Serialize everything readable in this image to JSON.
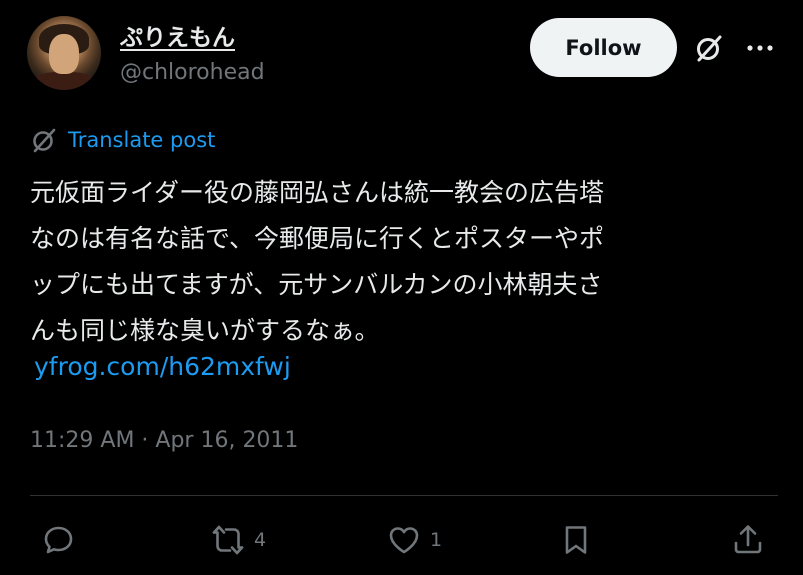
{
  "author": {
    "display_name": "ぷりえもん",
    "handle": "@chlorohead",
    "avatar_icon": "avatar"
  },
  "header": {
    "follow_label": "Follow",
    "grok_icon": "grok-icon",
    "more_icon": "more-icon"
  },
  "translate": {
    "icon": "translate-icon",
    "label": "Translate post"
  },
  "post": {
    "lines": [
      "元仮面ライダー役の藤岡弘さんは統一教会の広告塔",
      "なのは有名な話で、今郵便局に行くとポスターやポ",
      "ップにも出てますが、元サンバルカンの小林朝夫さ",
      "んも同じ様な臭いがするなぁ。"
    ],
    "link": "yfrog.com/h62mxfwj",
    "timestamp": "11:29 AM · Apr 16, 2011"
  },
  "actions": {
    "reply": {
      "icon": "reply-icon",
      "count": ""
    },
    "repost": {
      "icon": "repost-icon",
      "count": "4"
    },
    "like": {
      "icon": "heart-icon",
      "count": "1"
    },
    "bookmark": {
      "icon": "bookmark-icon",
      "count": ""
    },
    "share": {
      "icon": "share-icon",
      "count": ""
    }
  },
  "colors": {
    "background": "#000000",
    "text": "#e7e9ea",
    "secondary": "#71767b",
    "accent": "#1d9bf0",
    "follow_bg": "#eff3f4"
  }
}
